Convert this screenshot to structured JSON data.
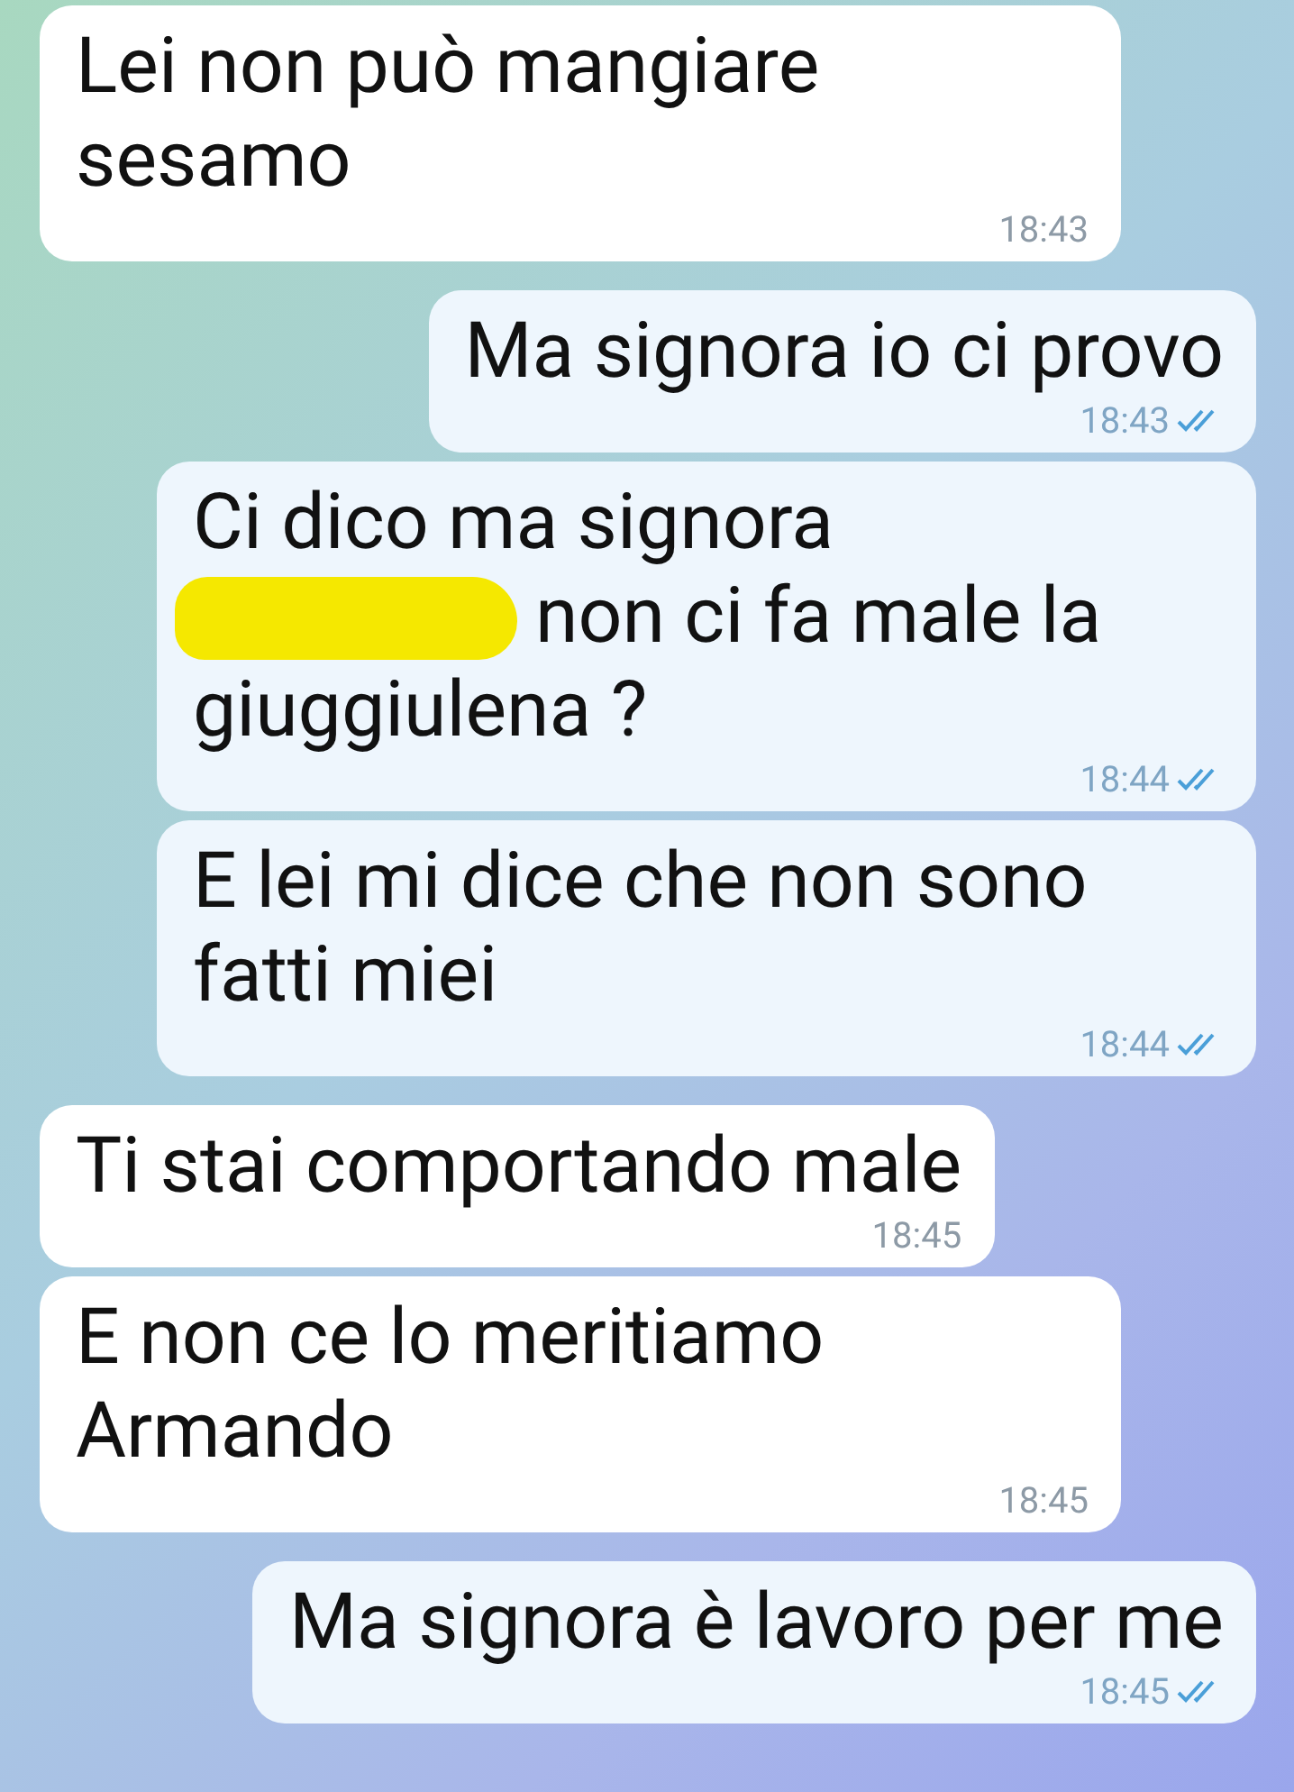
{
  "messages": [
    {
      "kind": "incoming",
      "text": "Lei non può mangiare sesamo",
      "time": "18:43"
    },
    {
      "kind": "outgoing",
      "text": "Ma signora io ci provo",
      "time": "18:43",
      "read": true
    },
    {
      "kind": "outgoing",
      "lead": "Ci dico ma signora",
      "redaction": true,
      "text": "non ci fa male la giuggiulena ?",
      "time": "18:44",
      "read": true
    },
    {
      "kind": "outgoing",
      "text": "E lei mi dice che non sono fatti miei",
      "time": "18:44",
      "read": true
    },
    {
      "kind": "incoming",
      "text": "Ti stai comportando male",
      "time": "18:45"
    },
    {
      "kind": "incoming",
      "text": "E non ce lo meritiamo Armando",
      "time": "18:45"
    },
    {
      "kind": "outgoing",
      "text": "Ma signora è lavoro per me",
      "time": "18:45",
      "read": true
    }
  ]
}
